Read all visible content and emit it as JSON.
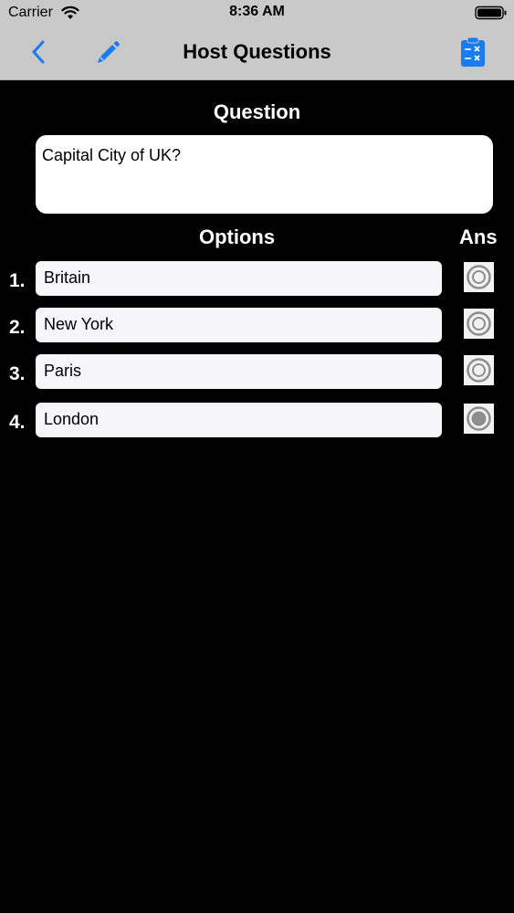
{
  "status_bar": {
    "carrier": "Carrier",
    "time": "8:36 AM",
    "icons": [
      "wifi-icon",
      "battery-icon"
    ]
  },
  "nav": {
    "title": "Host Questions",
    "icons": [
      "back-chevron-icon",
      "pencil-icon",
      "clipboard-icon"
    ],
    "accent_color": "#1a7cf3"
  },
  "question": {
    "heading": "Question",
    "text": "Capital City of UK?"
  },
  "options": {
    "heading": "Options",
    "answer_heading": "Ans",
    "items": [
      {
        "number": "1.",
        "text": "Britain",
        "selected": false
      },
      {
        "number": "2.",
        "text": "New York",
        "selected": false
      },
      {
        "number": "3.",
        "text": "Paris",
        "selected": false
      },
      {
        "number": "4.",
        "text": "London",
        "selected": true
      }
    ]
  }
}
